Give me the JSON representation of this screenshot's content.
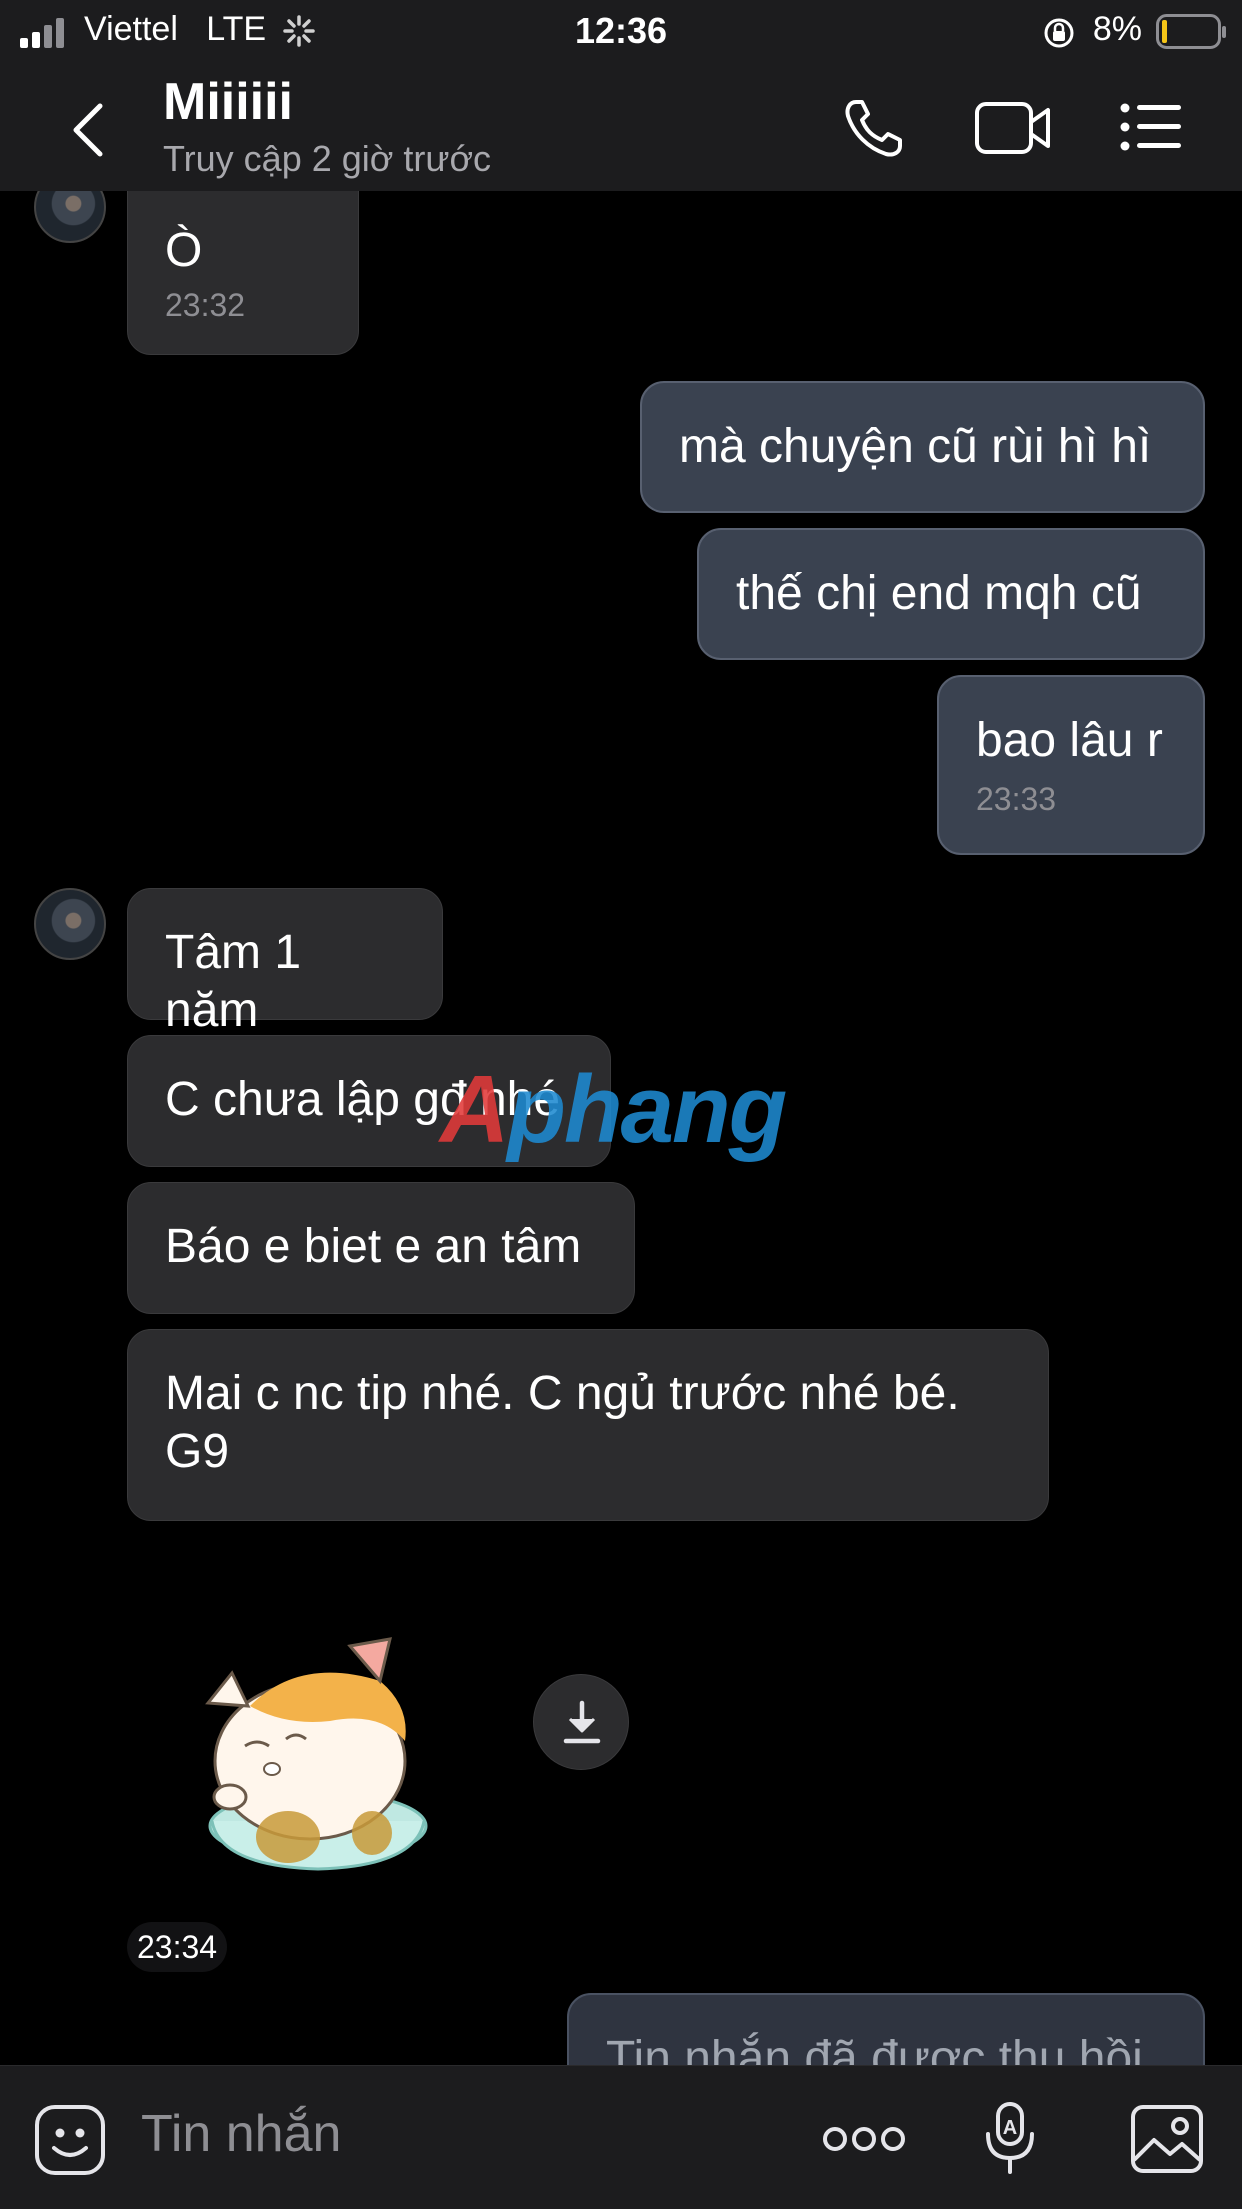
{
  "status": {
    "carrier": "Viettel",
    "network": "LTE",
    "time": "12:36",
    "battery": "8%"
  },
  "header": {
    "title": "Miiiiii",
    "subtitle": "Truy cập 2 giờ trước",
    "back_icon": "chevron-left-icon",
    "call_icon": "phone-icon",
    "video_icon": "video-camera-icon",
    "menu_icon": "list-menu-icon"
  },
  "messages": [
    {
      "text": "Ò",
      "time": "23:32"
    },
    {
      "text": "mà chuyện cũ rùi hì hì"
    },
    {
      "text": "thế chị end mqh cũ"
    },
    {
      "text": "bao lâu r",
      "time": "23:33"
    },
    {
      "text": "Tâm 1 năm"
    },
    {
      "text": "C chưa lập gđ nhé"
    },
    {
      "text": "Báo e biet e an tâm"
    },
    {
      "text": "Mai c nc tip nhé. C ngủ trước nhé bé.\nG9"
    },
    {
      "sticker": "sleeping-cat-in-bowl-sticker",
      "time": "23:34"
    },
    {
      "text": "Tin nhắn đã được thu hồi"
    }
  ],
  "watermark": {
    "prefix": "A",
    "text": "phang"
  },
  "composer": {
    "placeholder": "Tin nhắn",
    "emoji_icon": "emoji-icon",
    "more_icon": "more-dots-icon",
    "voice_icon": "voice-to-text-icon",
    "image_icon": "image-icon"
  },
  "colors": {
    "background": "#000000",
    "bar": "#1c1c1e",
    "received_bubble": "#2c2c2e",
    "sent_bubble": "#3a4250",
    "battery_low": "#f5c518"
  }
}
